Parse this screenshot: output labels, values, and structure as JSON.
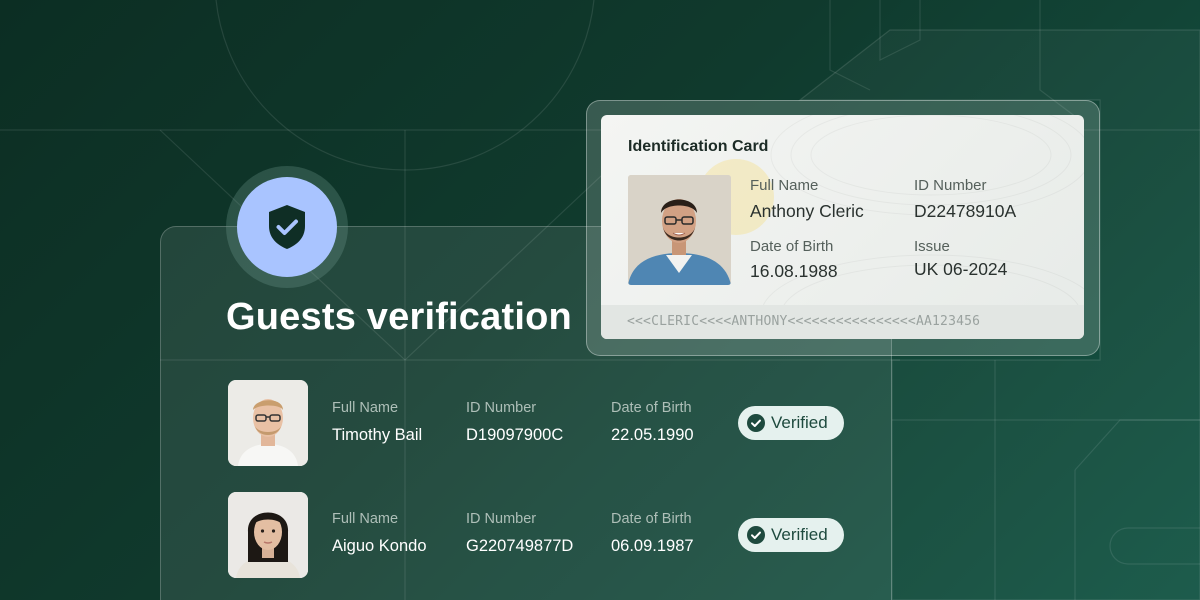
{
  "header": {
    "title": "Guests verification"
  },
  "icons": {
    "shield": "shield-check-icon",
    "verified": "check-circle-icon"
  },
  "colors": {
    "background": "#103a2d",
    "shield_accent": "#a9c4ff",
    "badge_bg": "#e5f1ee",
    "badge_text": "#1e4a3e"
  },
  "guests": [
    {
      "full_name_label": "Full Name",
      "full_name": "Timothy Bail",
      "id_label": "ID Number",
      "id_number": "D19097900C",
      "dob_label": "Date of Birth",
      "dob": "22.05.1990",
      "status": "Verified"
    },
    {
      "full_name_label": "Full Name",
      "full_name": "Aiguo Kondo",
      "id_label": "ID Number",
      "id_number": "G220749877D",
      "dob_label": "Date of Birth",
      "dob": "06.09.1987",
      "status": "Verified"
    }
  ],
  "id_card": {
    "title": "Identification Card",
    "full_name_label": "Full Name",
    "full_name": "Anthony Cleric",
    "id_label": "ID Number",
    "id_number": "D22478910A",
    "dob_label": "Date of Birth",
    "dob": "16.08.1988",
    "issue_label": "Issue",
    "issue": "UK 06-2024",
    "mrz": "<<<CLERIC<<<<ANTHONY<<<<<<<<<<<<<<<<AA123456"
  }
}
